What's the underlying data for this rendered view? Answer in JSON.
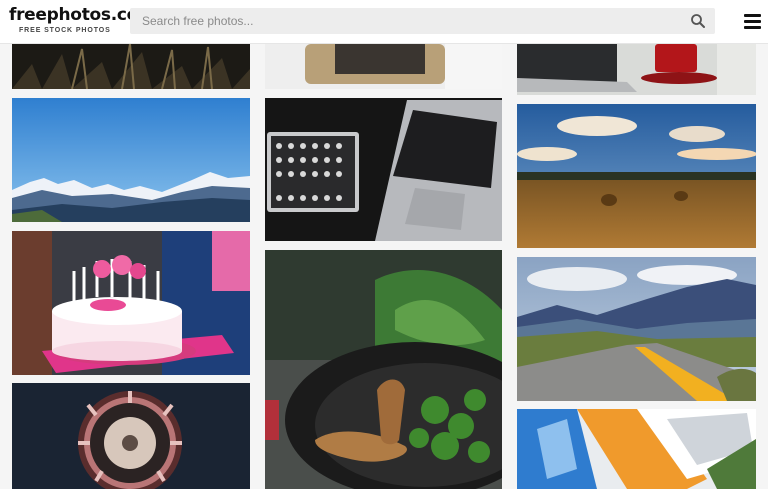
{
  "header": {
    "logo_title": "freephotos.cc",
    "logo_tagline": "FREE STOCK PHOTOS",
    "search_placeholder": "Search free photos..."
  },
  "icons": {
    "search": "search-icon",
    "menu": "hamburger-menu-icon"
  },
  "colors": {
    "header_bg": "#ffffff",
    "search_bg": "#ededed",
    "page_bg": "#f5f5f5"
  }
}
